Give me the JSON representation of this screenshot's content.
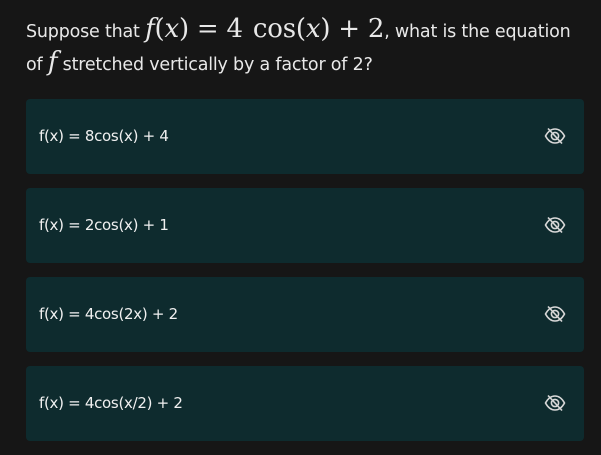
{
  "question": {
    "prefix": "Suppose that",
    "math": {
      "f": "f",
      "open": "(",
      "x1": "x",
      "close_eq": ")",
      "equals": "=",
      "coef": "4",
      "fn": "cos",
      "open2": "(",
      "x2": "x",
      "close2": ")",
      "plus": "+",
      "const": "2"
    },
    "comma_text": ", what is the equation",
    "line2_prefix": "of",
    "line2_f": "f",
    "line2_suffix": "stretched vertically by a factor of 2?"
  },
  "options": [
    {
      "label": "f(x) = 8cos(x) + 4",
      "icon": "eye-off-icon"
    },
    {
      "label": "f(x) = 2cos(x) + 1",
      "icon": "eye-off-icon"
    },
    {
      "label": "f(x) = 4cos(2x) + 2",
      "icon": "eye-off-icon"
    },
    {
      "label": "f(x) = 4cos(x/2) + 2",
      "icon": "eye-off-icon"
    }
  ],
  "colors": {
    "background": "#161616",
    "option_background": "#0e2b2e",
    "text": "#e8e8e8",
    "icon": "#d8d8d8"
  }
}
